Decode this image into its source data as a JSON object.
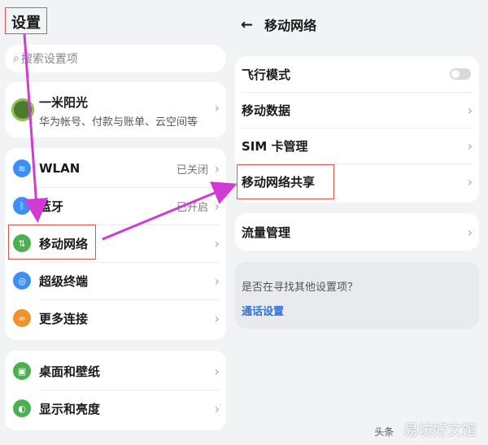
{
  "left": {
    "title": "设置",
    "search": {
      "placeholder": "搜索设置项",
      "icon": "search-icon"
    },
    "account": {
      "name": "一米阳光",
      "subtitle": "华为帐号、付款与账单、云空间等"
    },
    "connections": [
      {
        "label": "WLAN",
        "value": "已关闭",
        "icon": "wifi-icon",
        "color": "#3e8ef7"
      },
      {
        "label": "蓝牙",
        "value": "已开启",
        "icon": "bluetooth-icon",
        "color": "#3e8ef7"
      },
      {
        "label": "移动网络",
        "value": "",
        "icon": "mobile-network-icon",
        "color": "#4caf50"
      },
      {
        "label": "超级终端",
        "value": "",
        "icon": "super-device-icon",
        "color": "#3e8ef7"
      },
      {
        "label": "更多连接",
        "value": "",
        "icon": "more-connection-icon",
        "color": "#f0932b"
      }
    ],
    "display": [
      {
        "label": "桌面和壁纸",
        "icon": "wallpaper-icon",
        "color": "#4caf50"
      },
      {
        "label": "显示和亮度",
        "icon": "display-icon",
        "color": "#4caf50"
      }
    ]
  },
  "right": {
    "header": {
      "back_icon": "←",
      "title": "移动网络"
    },
    "card1": [
      "飞行模式",
      "移动数据",
      "SIM 卡管理",
      "移动网络共享"
    ],
    "card2": [
      "流量管理"
    ],
    "suggestion": {
      "question": "是否在寻找其他设置项？",
      "link": "通话设置"
    }
  },
  "watermark": {
    "source": "头条",
    "text": "易坊好文馆"
  }
}
